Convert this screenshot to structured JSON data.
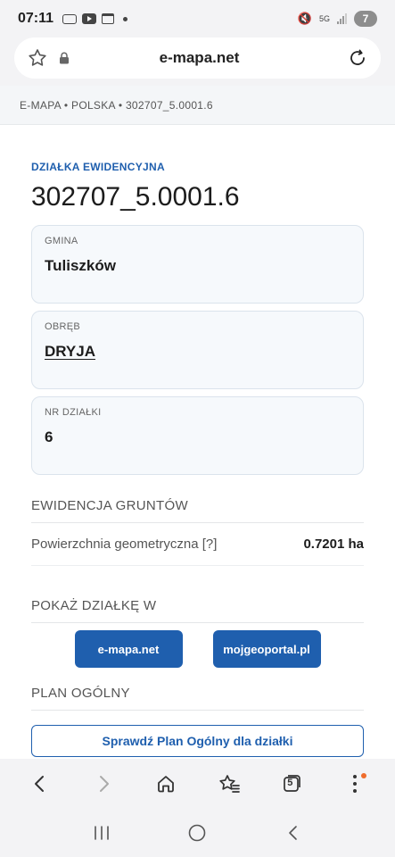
{
  "status": {
    "time": "07:11",
    "battery": "7",
    "network": "5G"
  },
  "browser": {
    "url": "e-mapa.net",
    "tab_count": "5"
  },
  "breadcrumb": "E-MAPA • POLSKA • 302707_5.0001.6",
  "parcel": {
    "kicker": "DZIAŁKA EWIDENCYJNA",
    "id": "302707_5.0001.6",
    "cards": [
      {
        "label": "GMINA",
        "value": "Tuliszków"
      },
      {
        "label": "OBRĘB",
        "value": "DRYJA"
      },
      {
        "label": "NR DZIAŁKI",
        "value": "6"
      }
    ]
  },
  "land_registry": {
    "heading": "EWIDENCJA GRUNTÓW",
    "area_label": "Powierzchnia geometryczna [?]",
    "area_value": "0.7201 ha"
  },
  "show_in": {
    "heading": "POKAŻ DZIAŁKĘ W",
    "btn_emapa": "e-mapa.net",
    "btn_geoportal": "mojgeoportal.pl"
  },
  "plan": {
    "heading": "PLAN OGÓLNY",
    "btn_pre": "Sprawdź",
    "btn_bold": "Plan Ogólny",
    "btn_post": "dla działki"
  },
  "colors": {
    "accent": "#1f5fae",
    "notify": "#ef6c2c"
  }
}
